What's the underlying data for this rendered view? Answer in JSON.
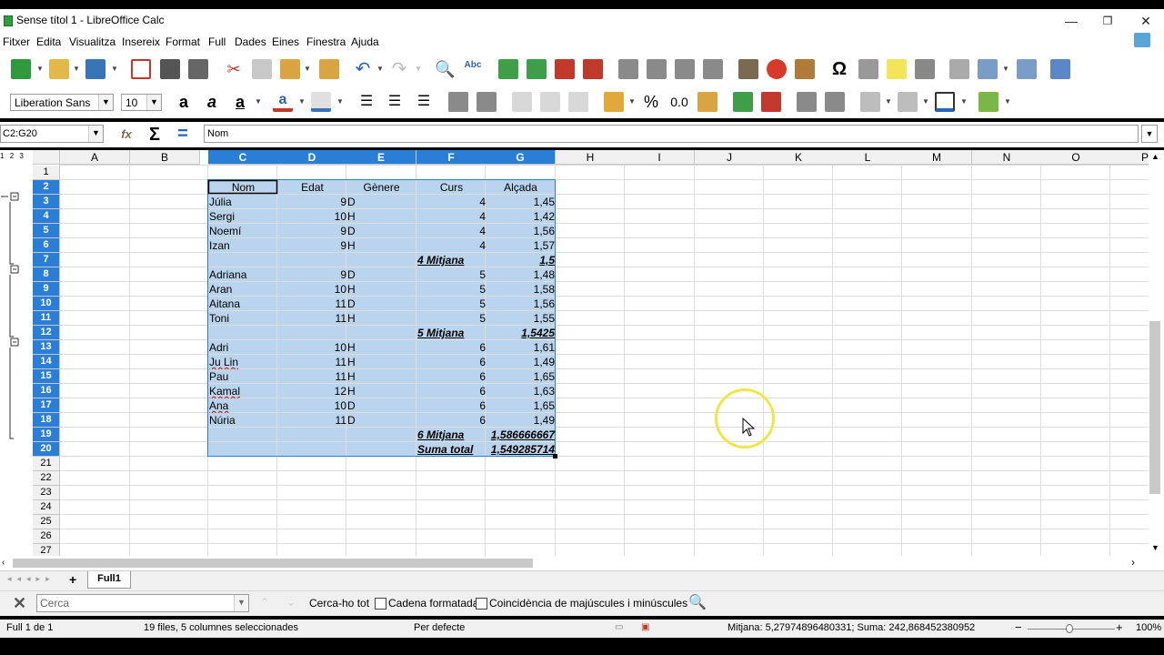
{
  "window": {
    "title": "Sense títol 1 - LibreOffice Calc",
    "minimize": "—",
    "maximize": "❐",
    "close": "✕"
  },
  "menu": [
    "Fitxer",
    "Edita",
    "Visualitza",
    "Insereix",
    "Format",
    "Full",
    "Dades",
    "Eines",
    "Finestra",
    "Ajuda"
  ],
  "format_toolbar": {
    "font_name": "Liberation Sans",
    "font_size": "10",
    "percent": "%",
    "decimal": "0.0"
  },
  "formula_bar": {
    "name_box": "C2:G20",
    "content": "Nom",
    "sum_icon": "Σ",
    "equals_icon": "="
  },
  "outline_levels": [
    "1",
    "2",
    "3"
  ],
  "columns": [
    "A",
    "B",
    "C",
    "D",
    "E",
    "F",
    "G",
    "H",
    "I",
    "J",
    "K",
    "L",
    "M",
    "N",
    "O",
    "P"
  ],
  "selected_columns": [
    "C",
    "D",
    "E",
    "F",
    "G"
  ],
  "rows": [
    "1",
    "2",
    "3",
    "4",
    "5",
    "6",
    "7",
    "8",
    "9",
    "10",
    "11",
    "12",
    "13",
    "14",
    "15",
    "16",
    "17",
    "18",
    "19",
    "20",
    "21",
    "22",
    "23",
    "24",
    "25",
    "26",
    "27"
  ],
  "selected_rows": [
    "2",
    "3",
    "4",
    "5",
    "6",
    "7",
    "8",
    "9",
    "10",
    "11",
    "12",
    "13",
    "14",
    "15",
    "16",
    "17",
    "18",
    "19",
    "20"
  ],
  "table": {
    "headers": [
      "Nom",
      "Edat",
      "Gènere",
      "Curs",
      "Alçada"
    ],
    "rows": [
      {
        "nom": "Júlia",
        "edat": "9",
        "genere": "D",
        "curs": "4",
        "alcada": "1,45"
      },
      {
        "nom": "Sergi",
        "edat": "10",
        "genere": "H",
        "curs": "4",
        "alcada": "1,42"
      },
      {
        "nom": "Noemí",
        "edat": "9",
        "genere": "D",
        "curs": "4",
        "alcada": "1,56"
      },
      {
        "nom": "Izan",
        "edat": "9",
        "genere": "H",
        "curs": "4",
        "alcada": "1,57"
      },
      {
        "subtotal_label": "4 Mitjana",
        "subtotal_value": "1,5"
      },
      {
        "nom": "Adriana",
        "edat": "9",
        "genere": "D",
        "curs": "5",
        "alcada": "1,48"
      },
      {
        "nom": "Aran",
        "edat": "10",
        "genere": "H",
        "curs": "5",
        "alcada": "1,58"
      },
      {
        "nom": "Aitana",
        "edat": "11",
        "genere": "D",
        "curs": "5",
        "alcada": "1,56"
      },
      {
        "nom": "Toni",
        "edat": "11",
        "genere": "H",
        "curs": "5",
        "alcada": "1,55"
      },
      {
        "subtotal_label": "5 Mitjana",
        "subtotal_value": "1,5425"
      },
      {
        "nom": "Adri",
        "edat": "10",
        "genere": "H",
        "curs": "6",
        "alcada": "1,61"
      },
      {
        "nom": "Ju Lin",
        "edat": "11",
        "genere": "H",
        "curs": "6",
        "alcada": "1,49"
      },
      {
        "nom": "Pau",
        "edat": "11",
        "genere": "H",
        "curs": "6",
        "alcada": "1,65"
      },
      {
        "nom": "Kamal",
        "edat": "12",
        "genere": "H",
        "curs": "6",
        "alcada": "1,63"
      },
      {
        "nom": "Ana",
        "edat": "10",
        "genere": "D",
        "curs": "6",
        "alcada": "1,65"
      },
      {
        "nom": "Núria",
        "edat": "11",
        "genere": "D",
        "curs": "6",
        "alcada": "1,49"
      },
      {
        "subtotal_label": "6 Mitjana",
        "subtotal_value": "1,586666667"
      },
      {
        "subtotal_label": "Suma total",
        "subtotal_value": "1,549285714"
      }
    ]
  },
  "sheet_tabs": {
    "add": "+",
    "active": "Full1"
  },
  "find_toolbar": {
    "placeholder": "Cerca",
    "find_all": "Cerca-ho tot",
    "formatted": "Cadena formatada",
    "match_case": "Coincidència de majúscules i minúscules"
  },
  "status_bar": {
    "sheet": "Full 1 de 1",
    "selection": "19 files, 5 columnes seleccionades",
    "page_style": "Per defecte",
    "stats": "Mitjana: 5,27974896480331; Suma: 242,868452380952",
    "zoom": "100%",
    "zoom_out": "−",
    "zoom_in": "+"
  },
  "colors": {
    "selection_fill": "#b9d4ec",
    "header_selected": "#2a7ed6",
    "highlight_circle": "#f0e64a"
  }
}
